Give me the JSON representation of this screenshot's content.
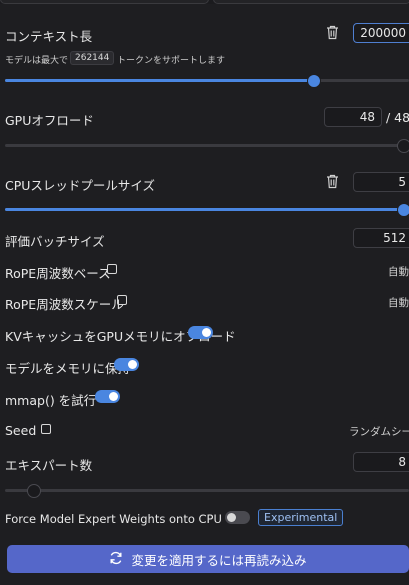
{
  "context": {
    "label": "コンテキスト長",
    "value": "200000",
    "hint_prefix": "モデルは最大で",
    "max_tokens": "262144",
    "hint_suffix": "トークンをサポートします",
    "slider_fraction": 0.763
  },
  "gpu_offload": {
    "label": "GPUオフロード",
    "value": "48",
    "max": "/ 48",
    "slider_fraction": 1.0
  },
  "cpu_threads": {
    "label": "CPUスレッドプールサイズ",
    "value": "5",
    "slider_fraction": 1.0
  },
  "eval_batch": {
    "label": "評価バッチサイズ",
    "value": "512"
  },
  "rope_base": {
    "label": "RoPE周波数ベース",
    "right": "自動"
  },
  "rope_scale": {
    "label": "RoPE周波数スケール",
    "right": "自動"
  },
  "kv_offload": {
    "label": "KVキャッシュをGPUメモリにオフロード",
    "on": true
  },
  "keep_in_memory": {
    "label": "モデルをメモリに保持",
    "on": true
  },
  "mmap": {
    "label": "mmap() を試行",
    "on": true
  },
  "seed": {
    "label": "Seed",
    "right": "ランダムシード"
  },
  "experts": {
    "label": "エキスパート数",
    "value": "8",
    "slider_fraction": 0.07
  },
  "force_expert": {
    "label": "Force Model Expert Weights onto CPU",
    "on": false,
    "badge": "Experimental"
  },
  "apply_button": {
    "label": "変更を適用するには再読み込み"
  },
  "colors": {
    "accent": "#4a86e0",
    "button": "#5567c9",
    "background": "#1e1e21"
  }
}
